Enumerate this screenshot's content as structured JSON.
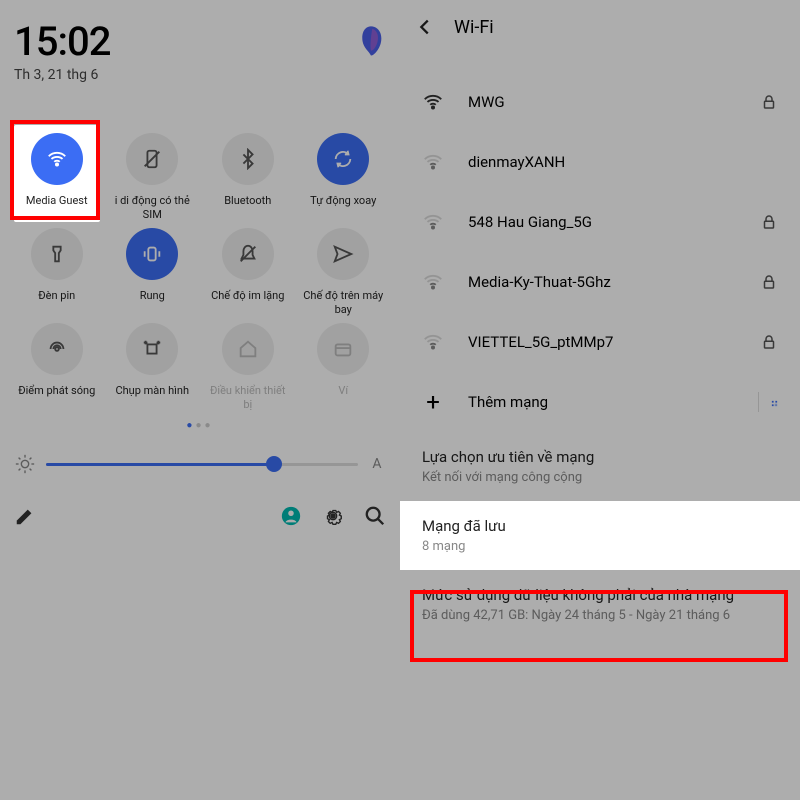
{
  "left": {
    "time": "15:02",
    "date": "Th 3, 21 thg 6",
    "tiles": [
      {
        "label": "Media Guest",
        "icon": "wifi",
        "on": true
      },
      {
        "label": "i di động\ncó thẻ SIM",
        "icon": "sim",
        "on": false
      },
      {
        "label": "Bluetooth",
        "icon": "bluetooth",
        "on": false
      },
      {
        "label": "Tự động xoay",
        "icon": "rotate",
        "on": true
      },
      {
        "label": "Đèn pin",
        "icon": "torch",
        "on": false
      },
      {
        "label": "Rung",
        "icon": "vibrate",
        "on": true
      },
      {
        "label": "Chế độ im lặng",
        "icon": "mute",
        "on": false
      },
      {
        "label": "Chế độ trên máy bay",
        "icon": "airplane",
        "on": false
      },
      {
        "label": "Điểm phát sóng",
        "icon": "hotspot",
        "on": false
      },
      {
        "label": "Chụp màn hình",
        "icon": "screenshot",
        "on": false
      },
      {
        "label": "Điều khiển thiết bị",
        "icon": "home",
        "on": false,
        "disabled": true
      },
      {
        "label": "Ví",
        "icon": "wallet",
        "on": false,
        "disabled": true
      }
    ],
    "brightness_pct": 73,
    "auto_label": "A"
  },
  "right": {
    "title": "Wi-Fi",
    "networks": [
      {
        "name": "MWG",
        "strength": "full",
        "locked": true
      },
      {
        "name": "dienmayXANH",
        "strength": "weak",
        "locked": false
      },
      {
        "name": "548 Hau Giang_5G",
        "strength": "weak",
        "locked": true
      },
      {
        "name": "Media-Ky-Thuat-5Ghz",
        "strength": "weak",
        "locked": true
      },
      {
        "name": "VIETTEL_5G_ptMMp7",
        "strength": "weak",
        "locked": true
      }
    ],
    "add_label": "Thêm mạng",
    "pref": {
      "title": "Lựa chọn ưu tiên về mạng",
      "sub": "Kết nối với mạng công cộng"
    },
    "saved": {
      "title": "Mạng đã lưu",
      "sub": "8 mạng"
    },
    "usage": {
      "title": "Mức sử dụng dữ liệu không phải của nhà mạng",
      "sub": "Đã dùng 42,71 GB: Ngày 24 tháng 5 - Ngày 21 tháng 6"
    }
  }
}
